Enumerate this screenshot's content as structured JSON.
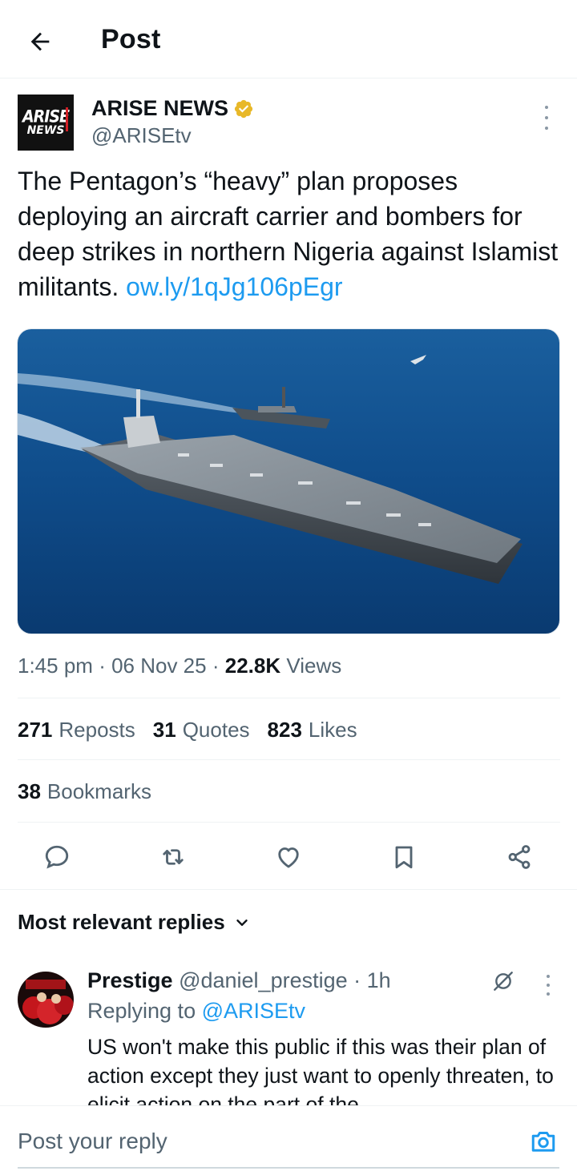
{
  "header": {
    "title": "Post",
    "back_icon": "arrow-left-icon"
  },
  "author": {
    "logo_line1": "ARISE",
    "logo_line2": "NEWS",
    "name": "ARISE NEWS",
    "handle": "@ARISEtv",
    "verified_badge": "gold-verified-icon",
    "badge_color": "#e8b829"
  },
  "post": {
    "text": "The Pentagon’s “heavy” plan proposes deploying an aircraft carrier and bombers for deep strikes in northern Nigeria against Islamist militants.",
    "link": "ow.ly/1qJg106pEgr",
    "media_alt": "aircraft carrier and destroyer at sea"
  },
  "meta": {
    "time": "1:45 pm",
    "date": "06 Nov 25",
    "views_count": "22.8K",
    "views_label": "Views"
  },
  "stats": {
    "reposts_count": "271",
    "reposts_label": "Reposts",
    "quotes_count": "31",
    "quotes_label": "Quotes",
    "likes_count": "823",
    "likes_label": "Likes",
    "bookmarks_count": "38",
    "bookmarks_label": "Bookmarks"
  },
  "actions": [
    "reply-icon",
    "repost-icon",
    "like-icon",
    "bookmark-icon",
    "share-icon"
  ],
  "replies": {
    "sort_label": "Most relevant replies",
    "items": [
      {
        "name": "Prestige",
        "handle": "@daniel_prestige",
        "time": "1h",
        "replying_prefix": "Replying to",
        "replying_to": "@ARISEtv",
        "text": "US won't make this public if this was their plan of action except they just want to openly threaten, to elicit action on the part of the"
      }
    ]
  },
  "composer": {
    "placeholder": "Post your reply"
  },
  "colors": {
    "accent": "#1d9bf0",
    "text": "#0f1419",
    "secondary": "#536471"
  }
}
